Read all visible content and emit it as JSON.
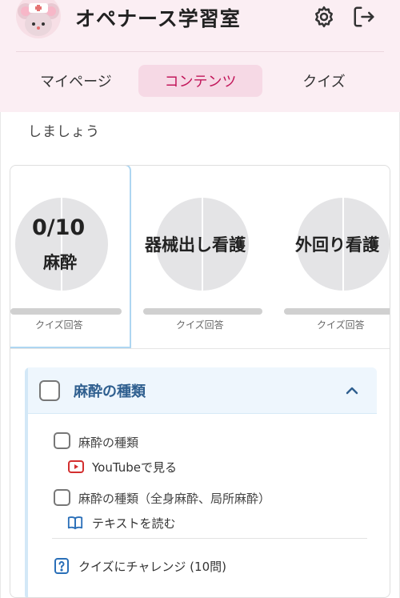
{
  "header": {
    "app_title": "オペナース学習室",
    "avatar_icon": "mouse-nurse-avatar-icon",
    "settings_icon": "gear-icon",
    "logout_icon": "logout-icon"
  },
  "tabs": [
    {
      "label": "マイページ",
      "active": false
    },
    {
      "label": "コンテンツ",
      "active": true
    },
    {
      "label": "クイズ",
      "active": false
    }
  ],
  "intro_text": "しましょう",
  "categories": [
    {
      "progress": "0/10",
      "label": "麻酔",
      "sub": "クイズ回答",
      "progress_fraction": 0,
      "selected": true
    },
    {
      "progress": "",
      "label": "器械出し看護",
      "sub": "クイズ回答",
      "progress_fraction": 0,
      "selected": false
    },
    {
      "progress": "",
      "label": "外回り看護",
      "sub": "クイズ回答",
      "progress_fraction": 0,
      "selected": false
    }
  ],
  "section": {
    "title": "麻酔の種類",
    "expanded": true,
    "items": [
      {
        "title": "麻酔の種類",
        "link_label": "YouTubeで見る",
        "link_icon": "youtube-icon"
      },
      {
        "title": "麻酔の種類（全身麻酔、局所麻酔）",
        "link_label": "テキストを読む",
        "link_icon": "book-icon"
      }
    ],
    "quiz_label": "クイズにチャレンジ (10問)",
    "quiz_icon": "quiz-help-icon"
  },
  "colors": {
    "header_bg": "#fbeef3",
    "active_tab_bg": "#f6d9e5",
    "active_tab_text": "#c2185b",
    "section_title": "#2f5f8f",
    "link_icon_blue": "#2a6fb8",
    "youtube_red": "#d32f2f"
  }
}
